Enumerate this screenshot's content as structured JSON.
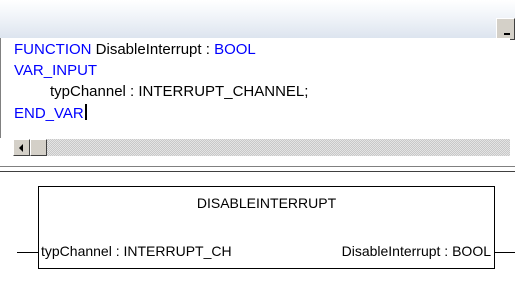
{
  "editor": {
    "line1": {
      "keyword1": "FUNCTION",
      "name": " DisableInterrupt : ",
      "keyword2": "BOOL"
    },
    "line2": {
      "keyword": "VAR_INPUT"
    },
    "line3": {
      "text": "typChannel : INTERRUPT_CHANNEL;"
    },
    "line4": {
      "keyword": "END_VAR"
    }
  },
  "diagram": {
    "block_title": "DISABLEINTERRUPT",
    "input_label": "typChannel : INTERRUPT_CH",
    "output_label": "DisableInterrupt : BOOL"
  },
  "colors": {
    "keyword": "#0000ff",
    "text": "#000000",
    "background": "#ffffff"
  }
}
